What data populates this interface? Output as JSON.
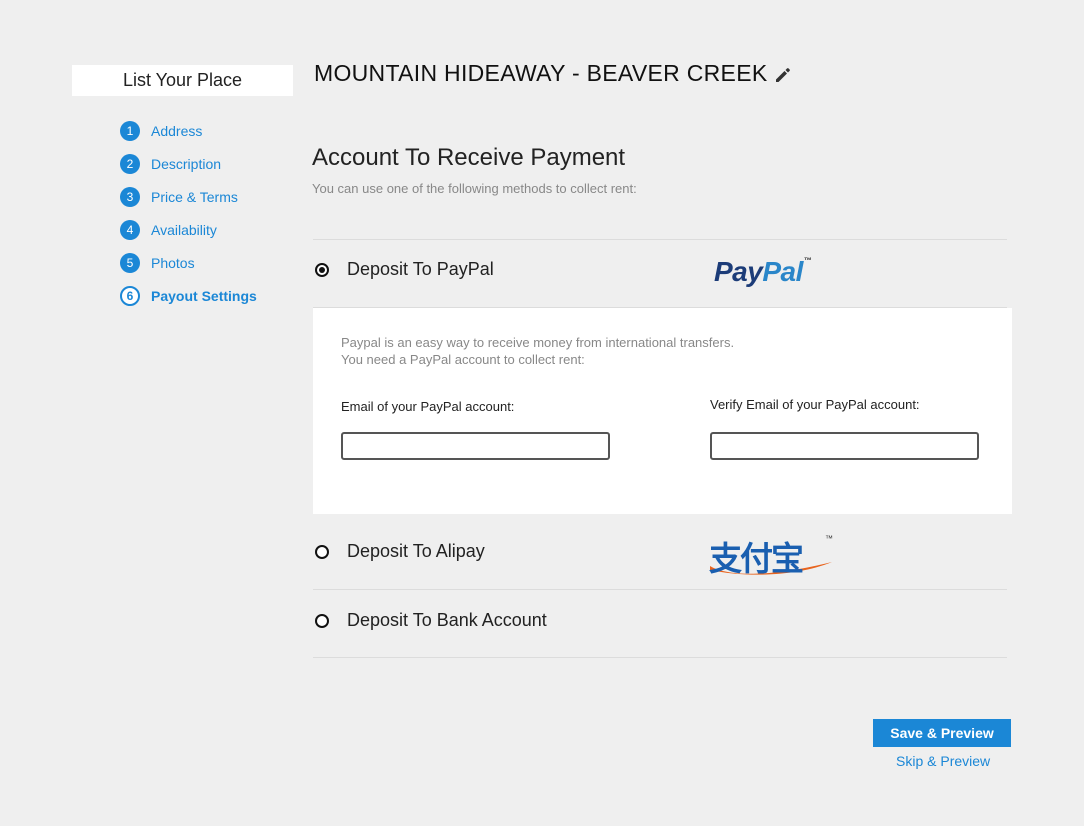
{
  "sidebar": {
    "title": "List Your Place",
    "steps": [
      {
        "num": "1",
        "label": "Address"
      },
      {
        "num": "2",
        "label": "Description"
      },
      {
        "num": "3",
        "label": "Price & Terms"
      },
      {
        "num": "4",
        "label": "Availability"
      },
      {
        "num": "5",
        "label": "Photos"
      },
      {
        "num": "6",
        "label": "Payout Settings",
        "active": true
      }
    ]
  },
  "header": {
    "place_name": "MOUNTAIN HIDEAWAY - BEAVER CREEK",
    "edit_icon": "pencil-icon"
  },
  "payment": {
    "title": "Account To Receive Payment",
    "subtitle": "You can use one of the following methods to collect rent:",
    "options": [
      {
        "label": "Deposit To PayPal",
        "selected": true,
        "logo_text_a": "Pay",
        "logo_text_b": "Pal",
        "logo_tm": "™"
      },
      {
        "label": "Deposit To Alipay",
        "selected": false,
        "logo_text": "支付宝",
        "logo_tm": "™"
      },
      {
        "label": "Deposit To Bank Account",
        "selected": false
      }
    ],
    "paypal_panel": {
      "line1": "Paypal is an easy way to receive money from international transfers.",
      "line2": "You need a PayPal account to collect rent:",
      "email_label": "Email of your PayPal account:",
      "email_value": "",
      "verify_label": "Verify Email of your PayPal account:",
      "verify_value": ""
    }
  },
  "actions": {
    "save_label": "Save & Preview",
    "skip_label": "Skip & Preview"
  },
  "colors": {
    "accent": "#1b87d6",
    "background": "#efefef",
    "paypal_dark": "#1c3c78",
    "paypal_light": "#2a86c9",
    "alipay_blue": "#1a5fb0",
    "alipay_orange": "#e8641e"
  }
}
